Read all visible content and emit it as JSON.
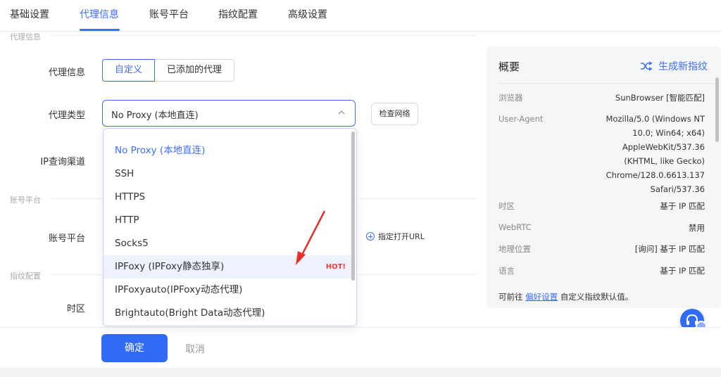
{
  "tabs": [
    "基础设置",
    "代理信息",
    "账号平台",
    "指纹配置",
    "高级设置"
  ],
  "sections": {
    "proxy": "代理信息",
    "account": "账号平台",
    "fingerprint": "指纹配置"
  },
  "labels": {
    "proxy_info": "代理信息",
    "proxy_type": "代理类型",
    "ip_channel": "IP查询渠道",
    "account_platform": "账号平台",
    "timezone": "时区"
  },
  "proxy_mode": {
    "custom": "自定义",
    "added": "已添加的代理"
  },
  "proxy_select": {
    "value": "No Proxy (本地直连)"
  },
  "check_network": "检查网络",
  "specify_url": "指定打开URL",
  "dropdown": {
    "options": [
      "No Proxy (本地直连)",
      "SSH",
      "HTTPS",
      "HTTP",
      "Socks5",
      "IPFoxy (IPFoxy静态独享)",
      "IPFoxyauto(IPFoxy动态代理)",
      "Brightauto(Bright Data动态代理)"
    ],
    "hot_badge": "HOT!"
  },
  "summary": {
    "title": "概要",
    "generate": "生成新指纹",
    "rows": [
      {
        "label": "浏览器",
        "value": "SunBrowser [智能匹配]"
      },
      {
        "label": "User-Agent",
        "value": "Mozilla/5.0 (Windows NT 10.0; Win64; x64) AppleWebKit/537.36 (KHTML, like Gecko) Chrome/128.0.6613.137 Safari/537.36"
      },
      {
        "label": "时区",
        "value": "基于 IP 匹配"
      },
      {
        "label": "WebRTC",
        "value": "禁用"
      },
      {
        "label": "地理位置",
        "value": "[询问] 基于 IP 匹配"
      },
      {
        "label": "语言",
        "value": "基于 IP 匹配"
      }
    ],
    "footer_prefix": "可前往",
    "footer_link": "偏好设置",
    "footer_suffix": "自定义指纹默认值。"
  },
  "buttons": {
    "confirm": "确定",
    "cancel": "取消"
  },
  "colors": {
    "accent": "#3d6ef6",
    "primary_button": "#2f6bf4",
    "hot": "#ee3b3b",
    "annotation_arrow": "#e8302a"
  }
}
